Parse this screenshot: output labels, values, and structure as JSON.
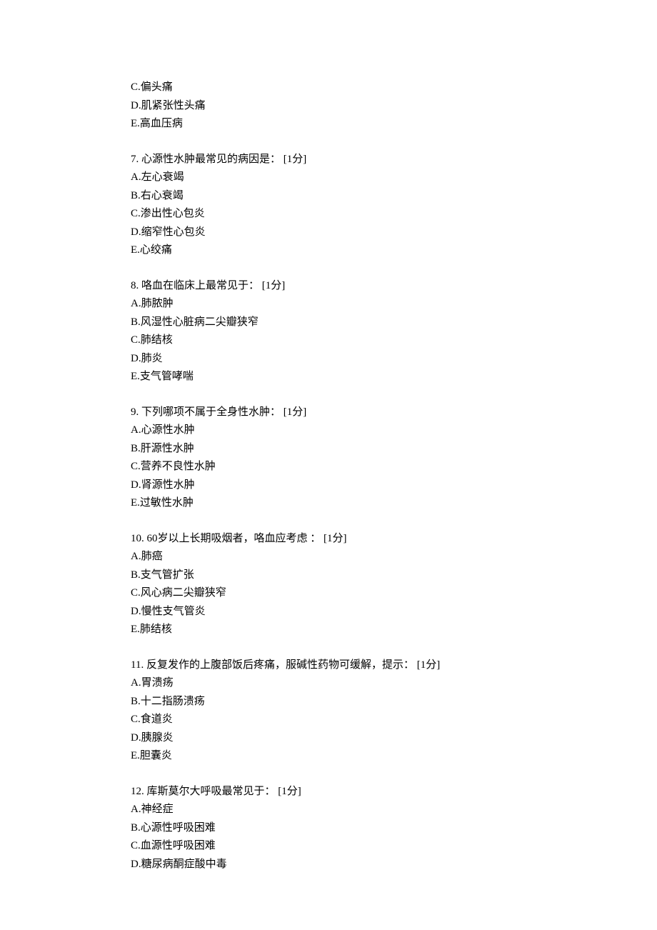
{
  "q6_remaining": {
    "options": [
      {
        "label": "C",
        "text": "偏头痛"
      },
      {
        "label": "D",
        "text": "肌紧张性头痛"
      },
      {
        "label": "E",
        "text": "高血压病"
      }
    ]
  },
  "questions": [
    {
      "num": "7",
      "text": "心源性水肿最常见的病因是：",
      "points": "[1分]",
      "options": [
        {
          "label": "A",
          "text": "左心衰竭"
        },
        {
          "label": "B",
          "text": "右心衰竭"
        },
        {
          "label": "C",
          "text": "渗出性心包炎"
        },
        {
          "label": "D",
          "text": "缩窄性心包炎"
        },
        {
          "label": "E",
          "text": "心绞痛"
        }
      ]
    },
    {
      "num": "8",
      "text": "咯血在临床上最常见于：",
      "points": "[1分]",
      "options": [
        {
          "label": "A",
          "text": "肺脓肿"
        },
        {
          "label": "B",
          "text": "风湿性心脏病二尖瓣狭窄"
        },
        {
          "label": "C",
          "text": "肺结核"
        },
        {
          "label": "D",
          "text": "肺炎"
        },
        {
          "label": "E",
          "text": "支气管哮喘"
        }
      ]
    },
    {
      "num": "9",
      "text": "下列哪项不属于全身性水肿：",
      "points": "[1分]",
      "options": [
        {
          "label": "A",
          "text": "心源性水肿"
        },
        {
          "label": "B",
          "text": "肝源性水肿"
        },
        {
          "label": "C",
          "text": "营养不良性水肿"
        },
        {
          "label": "D",
          "text": "肾源性水肿"
        },
        {
          "label": "E",
          "text": "过敏性水肿"
        }
      ]
    },
    {
      "num": "10",
      "text": "60岁以上长期吸烟者，咯血应考虑 ：",
      "points": "[1分]",
      "options": [
        {
          "label": "A",
          "text": "肺癌"
        },
        {
          "label": "B",
          "text": "支气管扩张"
        },
        {
          "label": "C",
          "text": "风心病二尖瓣狭窄"
        },
        {
          "label": "D",
          "text": "慢性支气管炎"
        },
        {
          "label": "E",
          "text": "肺结核"
        }
      ]
    },
    {
      "num": "11",
      "text": "反复发作的上腹部饭后疼痛，服碱性药物可缓解，提示：",
      "points": "[1分]",
      "options": [
        {
          "label": "A",
          "text": "胃溃疡"
        },
        {
          "label": "B",
          "text": "十二指肠溃疡"
        },
        {
          "label": "C",
          "text": "食道炎"
        },
        {
          "label": "D",
          "text": "胰腺炎"
        },
        {
          "label": "E",
          "text": "胆囊炎"
        }
      ]
    },
    {
      "num": "12",
      "text": "库斯莫尔大呼吸最常见于：",
      "points": "[1分]",
      "options": [
        {
          "label": "A",
          "text": "神经症"
        },
        {
          "label": "B",
          "text": "心源性呼吸困难"
        },
        {
          "label": "C",
          "text": "血源性呼吸困难"
        },
        {
          "label": "D",
          "text": "糖尿病酮症酸中毒"
        }
      ]
    }
  ]
}
